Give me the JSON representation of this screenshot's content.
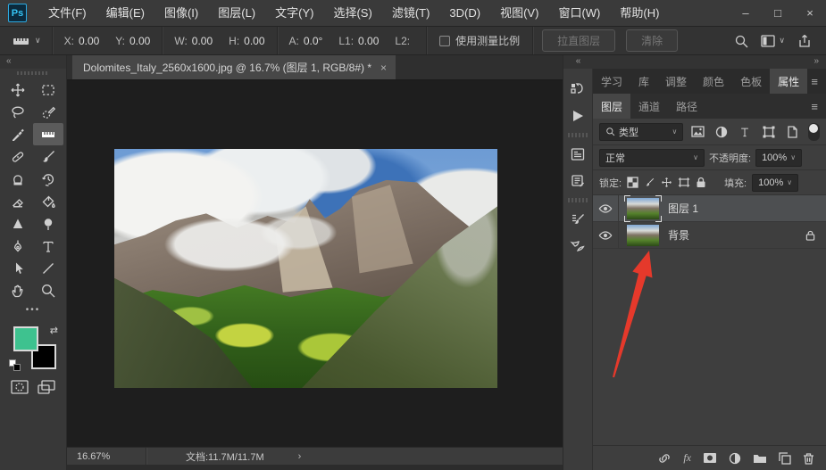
{
  "titlebar": {
    "app_icon": "Ps",
    "menus": [
      "文件(F)",
      "编辑(E)",
      "图像(I)",
      "图层(L)",
      "文字(Y)",
      "选择(S)",
      "滤镜(T)",
      "3D(D)",
      "视图(V)",
      "窗口(W)",
      "帮助(H)"
    ],
    "controls": {
      "minimize": "–",
      "maximize": "□",
      "close": "×"
    }
  },
  "options_bar": {
    "fields": [
      {
        "label": "X:",
        "value": "0.00"
      },
      {
        "label": "Y:",
        "value": "0.00"
      },
      {
        "label": "W:",
        "value": "0.00"
      },
      {
        "label": "H:",
        "value": "0.00"
      },
      {
        "label": "A:",
        "value": "0.0°"
      },
      {
        "label": "L1:",
        "value": "0.00"
      },
      {
        "label": "L2:",
        "value": ""
      }
    ],
    "use_measure_scale_label": "使用测量比例",
    "straighten_button": "拉直图层",
    "clear_button": "清除"
  },
  "document": {
    "tab_title": "Dolomites_Italy_2560x1600.jpg @ 16.7% (图层 1, RGB/8#) *",
    "tab_close": "×"
  },
  "status_bar": {
    "zoom": "16.67%",
    "doc_info": "文档:11.7M/11.7M",
    "chevron": "›"
  },
  "toolbar": {
    "tools": [
      "move-tool",
      "rectangular-marquee-tool",
      "lasso-tool",
      "quick-selection-tool",
      "eyedropper-tool",
      "ruler-tool",
      "spot-healing-brush-tool",
      "brush-tool",
      "clone-stamp-tool",
      "history-brush-tool",
      "eraser-tool",
      "paint-bucket-tool",
      "sharpen-tool",
      "dodge-tool",
      "pen-tool",
      "type-tool",
      "path-selection-tool",
      "line-tool",
      "hand-tool",
      "zoom-tool"
    ],
    "selected_tool": "ruler-tool"
  },
  "panels": {
    "top_tabs": [
      "学习",
      "库",
      "调整",
      "颜色",
      "色板",
      "属性"
    ],
    "top_active": "属性",
    "layer_tabs": [
      "图层",
      "通道",
      "路径"
    ],
    "layer_active": "图层"
  },
  "layers_panel": {
    "filter_label": "类型",
    "blend_mode": "正常",
    "opacity_label": "不透明度:",
    "opacity_value": "100%",
    "lock_label": "锁定:",
    "fill_label": "填充:",
    "fill_value": "100%",
    "fx_label": "fx",
    "layers": [
      {
        "name": "图层 1",
        "selected": true,
        "locked": false
      },
      {
        "name": "背景",
        "selected": false,
        "locked": true
      }
    ]
  },
  "colors": {
    "foreground": "#3ec28f",
    "background": "#000000",
    "arrow": "#e5392b"
  },
  "glyphs": {
    "chevron_down": "∨",
    "chevron_right": "›",
    "collapse_left": "«",
    "collapse_right": "»",
    "burger": "≡",
    "more_dots": "•••",
    "swap": "⇄"
  }
}
